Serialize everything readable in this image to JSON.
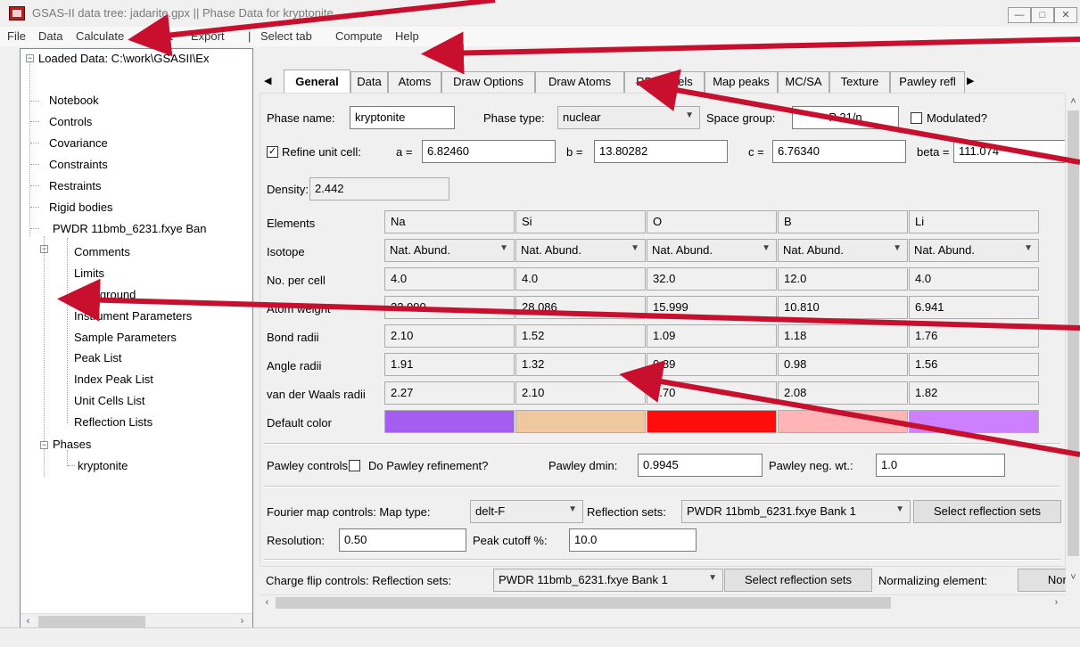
{
  "window": {
    "title": "GSAS-II data tree: jadarite.gpx || Phase Data for kryptonite",
    "icon_label": "GSAS-II"
  },
  "menu": [
    "File",
    "Data",
    "Calculate",
    "Import",
    "Export",
    "|",
    "Select tab",
    "Compute",
    "Help"
  ],
  "tree": {
    "root": "Loaded Data: C:\\work\\GSASII\\Ex",
    "top_items": [
      "Notebook",
      "Controls",
      "Covariance",
      "Constraints",
      "Restraints",
      "Rigid bodies"
    ],
    "histogram": "PWDR 11bmb_6231.fxye Ban",
    "histogram_items": [
      "Comments",
      "Limits",
      "Background",
      "Instrument Parameters",
      "Sample Parameters",
      "Peak List",
      "Index Peak List",
      "Unit Cells List",
      "Reflection Lists"
    ],
    "phases": "Phases",
    "phase_items": [
      "kryptonite"
    ]
  },
  "tabs": [
    "General",
    "Data",
    "Atoms",
    "Draw Options",
    "Draw Atoms",
    "RB Models",
    "Map peaks",
    "MC/SA",
    "Texture",
    "Pawley refl"
  ],
  "general": {
    "phase_name_label": "Phase name:",
    "phase_name": "kryptonite",
    "phase_type_label": "Phase type:",
    "phase_type": "nuclear",
    "space_group_label": "Space group:",
    "space_group": "P 21/n",
    "modulated_label": "Modulated?",
    "refine_cell_label": "Refine unit cell:",
    "a_label": "a =",
    "a": "6.82460",
    "b_label": "b =",
    "b": "13.80282",
    "c_label": "c =",
    "c": "6.76340",
    "beta_label": "beta =",
    "beta": "111.074",
    "density_label": "Density:",
    "density": "2.442"
  },
  "elements_table": {
    "row_labels": [
      "Elements",
      "Isotope",
      "No. per cell",
      "Atom weight",
      "Bond radii",
      "Angle radii",
      "van der Waals radii",
      "Default color"
    ],
    "elements": [
      "Na",
      "Si",
      "O",
      "B",
      "Li"
    ],
    "isotope": [
      "Nat. Abund.",
      "Nat. Abund.",
      "Nat. Abund.",
      "Nat. Abund.",
      "Nat. Abund."
    ],
    "no_per_cell": [
      "4.0",
      "4.0",
      "32.0",
      "12.0",
      "4.0"
    ],
    "atom_weight": [
      "22.990",
      "28.086",
      "15.999",
      "10.810",
      "6.941"
    ],
    "bond_radii": [
      "2.10",
      "1.52",
      "1.09",
      "1.18",
      "1.76"
    ],
    "angle_radii": [
      "1.91",
      "1.32",
      "0.89",
      "0.98",
      "1.56"
    ],
    "vdw_radii": [
      "2.27",
      "2.10",
      "1.70",
      "2.08",
      "1.82"
    ],
    "colors": [
      "#a55cf0",
      "#f0c8a0",
      "#ff0d0d",
      "#ffb5b5",
      "#cc80ff"
    ]
  },
  "pawley": {
    "controls_label": "Pawley controls:",
    "do_refinement_label": "Do Pawley refinement?",
    "dmin_label": "Pawley dmin:",
    "dmin": "0.9945",
    "neg_wt_label": "Pawley neg. wt.:",
    "neg_wt": "1.0"
  },
  "fourier": {
    "controls_label": "Fourier map controls: Map type:",
    "map_type": "delt-F",
    "reflection_sets_label": "Reflection sets:",
    "reflection_set": "PWDR 11bmb_6231.fxye Bank 1",
    "select_button": "Select reflection sets",
    "resolution_label": "Resolution:",
    "resolution": "0.50",
    "peak_cutoff_label": "Peak cutoff %:",
    "peak_cutoff": "10.0"
  },
  "charge_flip": {
    "controls_label": "Charge flip controls: Reflection sets:",
    "reflection_set": "PWDR 11bmb_6231.fxye Bank 1",
    "select_button": "Select reflection sets",
    "normalizing_label": "Normalizing element:",
    "normalizing_value": "None"
  },
  "colors": {
    "annotation_arrow": "#c8102e"
  }
}
